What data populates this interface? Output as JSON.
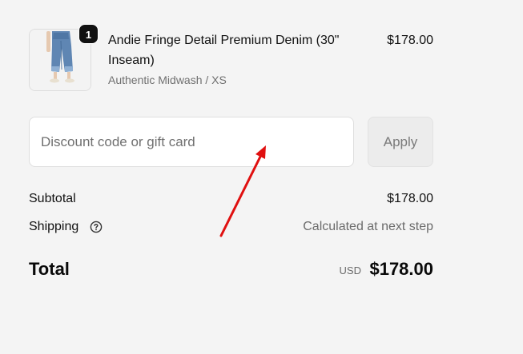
{
  "line_item": {
    "quantity": "1",
    "title": "Andie Fringe Detail Premium Denim (30\" Inseam)",
    "variant": "Authentic Midwash / XS",
    "price": "$178.00",
    "image_icon": "jeans-product-image"
  },
  "discount": {
    "placeholder": "Discount code or gift card",
    "value": "",
    "apply_label": "Apply"
  },
  "summary": {
    "subtotal_label": "Subtotal",
    "subtotal_value": "$178.00",
    "shipping_label": "Shipping",
    "shipping_help_icon": "question-circle-icon",
    "shipping_value": "Calculated at next step"
  },
  "total": {
    "label": "Total",
    "currency": "USD",
    "amount": "$178.00"
  },
  "colors": {
    "background": "#f4f4f4",
    "annotation_arrow": "#e01010",
    "badge": "#111111"
  }
}
